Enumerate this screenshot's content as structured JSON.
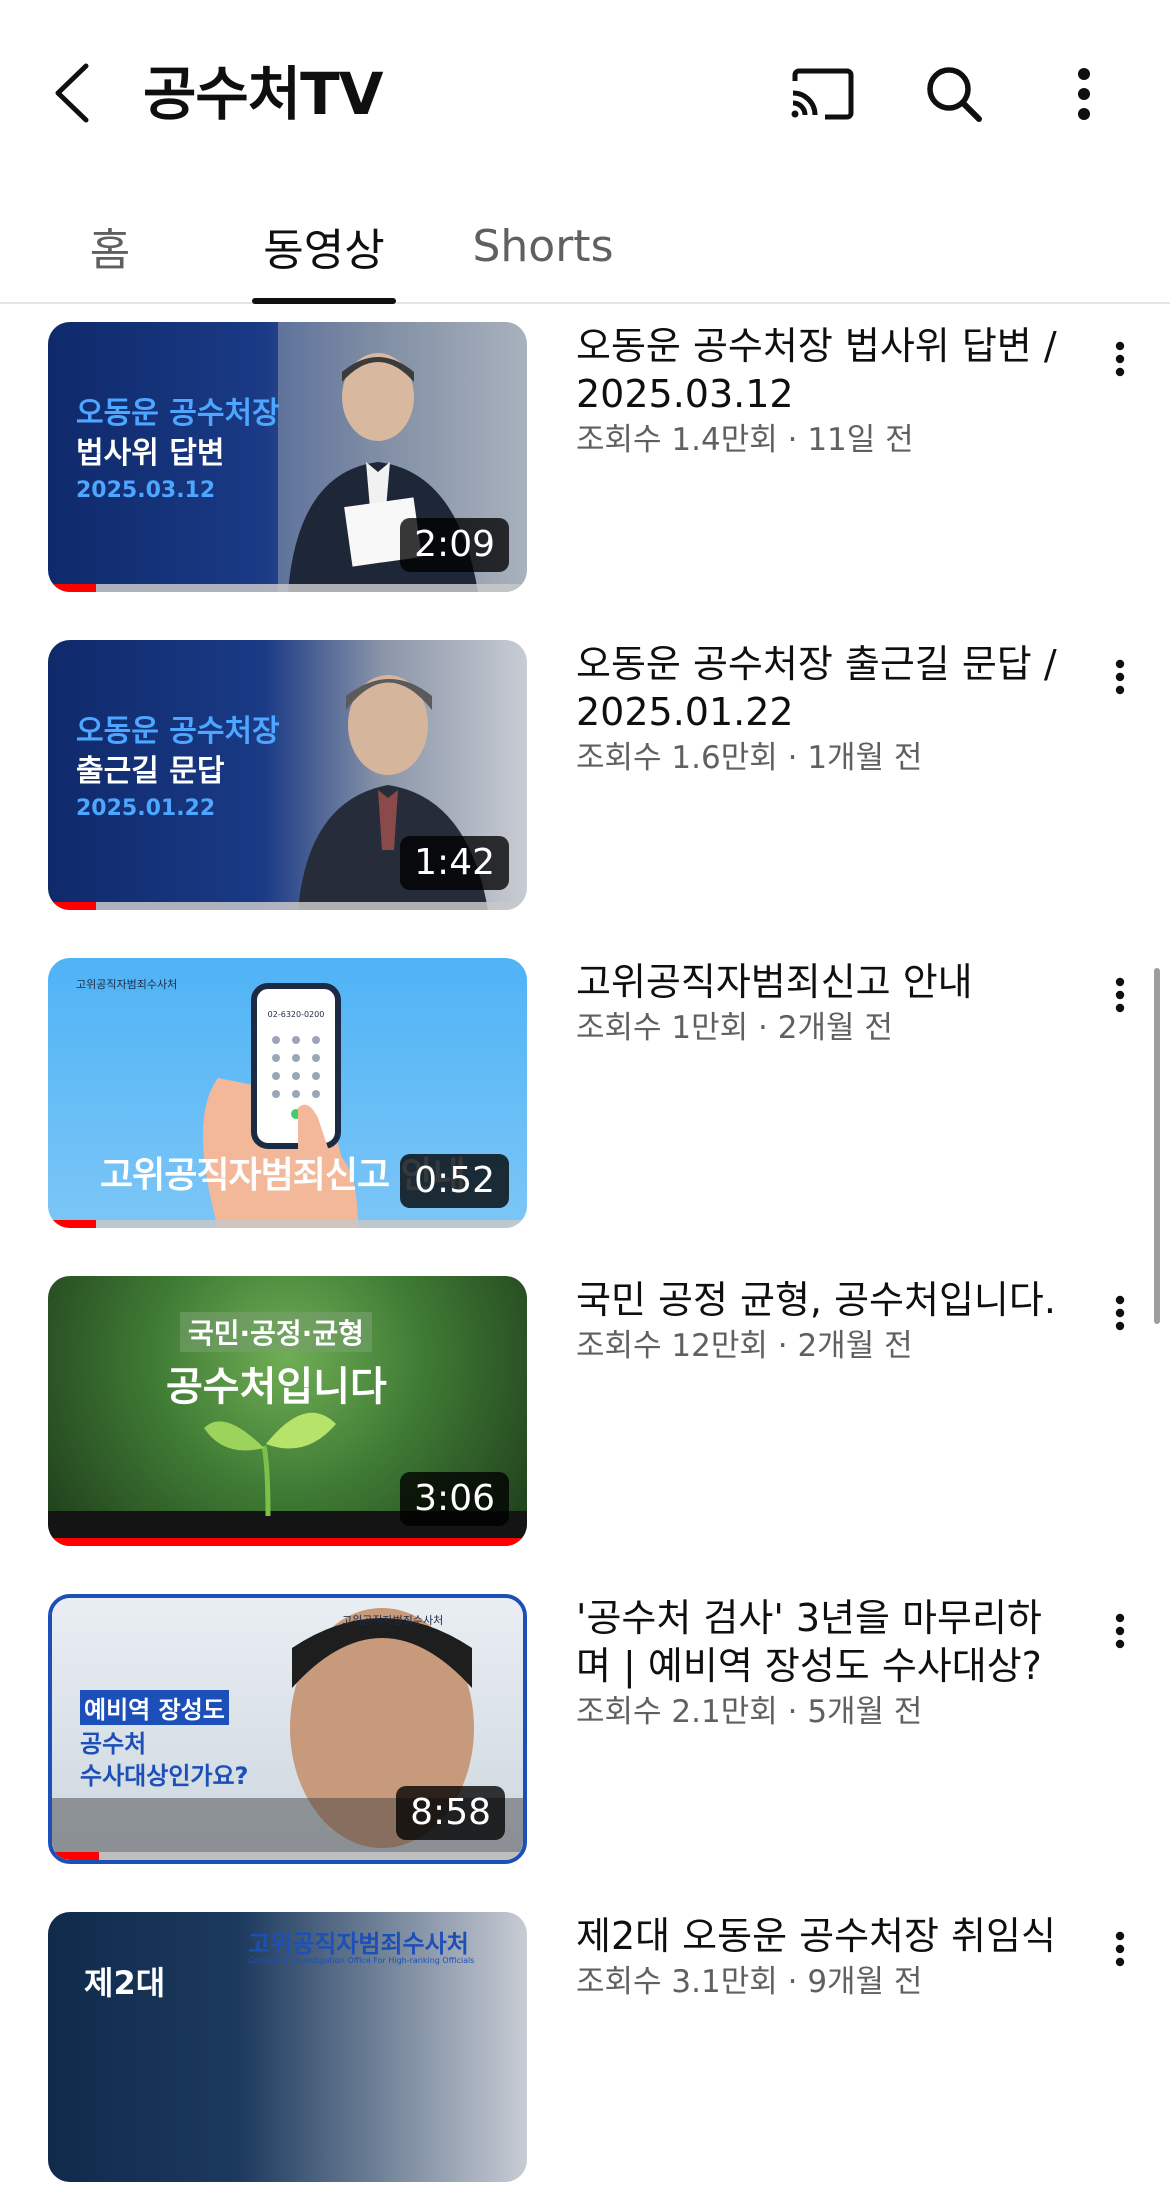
{
  "header": {
    "title": "공수처TV",
    "back_icon": "back-arrow-icon",
    "cast_icon": "cast-icon",
    "search_icon": "search-icon",
    "more_icon": "more-vert-icon"
  },
  "tabs": [
    {
      "label": "홈"
    },
    {
      "label": "동영상"
    },
    {
      "label": "Shorts"
    }
  ],
  "colors": {
    "progress": "#ff0000",
    "text_primary": "#0f0f0f",
    "text_secondary": "#606060"
  },
  "videos": [
    {
      "title": "오동운 공수처장 법사위 답변 / 2025.03.12",
      "stats": "조회수 1.4만회 · 11일 전",
      "duration": "2:09",
      "watched": 0.1,
      "thumb_text": {
        "line1": "오동운 공수처장",
        "line2": "법사위 답변",
        "line3": "2025.03.12"
      }
    },
    {
      "title": "오동운 공수처장 출근길 문답 / 2025.01.22",
      "stats": "조회수 1.6만회 · 1개월 전",
      "duration": "1:42",
      "watched": 0.1,
      "thumb_text": {
        "line1": "오동운 공수처장",
        "line2": "출근길 문답",
        "line3": "2025.01.22"
      }
    },
    {
      "title": "고위공직자범죄신고 안내",
      "stats": "조회수 1만회 · 2개월 전",
      "duration": "0:52",
      "watched": 0.1,
      "thumb_text": {
        "org": "고위공직자범죄수사처",
        "phone": "02-6320-0200",
        "caption": "고위공직자범죄신고 안내"
      }
    },
    {
      "title": "국민 공정 균형, 공수처입니다.",
      "stats": "조회수 12만회 · 2개월 전",
      "duration": "3:06",
      "watched": 1.0,
      "thumb_text": {
        "line1": "국민·공정·균형",
        "line2": "공수처입니다"
      }
    },
    {
      "title": "'공수처 검사' 3년을 마무리하며 | 예비역 장성도 수사대상?",
      "stats": "조회수 2.1만회 · 5개월 전",
      "duration": "8:58",
      "watched": 0.1,
      "thumb_text": {
        "line1": "예비역 장성도",
        "line2": "공수처",
        "line3": "수사대상인가요?",
        "org": "고위공직자범죄수사처"
      }
    },
    {
      "title": "제2대 오동운 공수처장 취임식",
      "stats": "조회수 3.1만회 · 9개월 전",
      "duration": "",
      "watched": 0,
      "thumb_text": {
        "line1": "제2대",
        "org": "고위공직자범죄수사처",
        "org_en": "Corruption Investigation Office For High-ranking Officials"
      }
    }
  ]
}
